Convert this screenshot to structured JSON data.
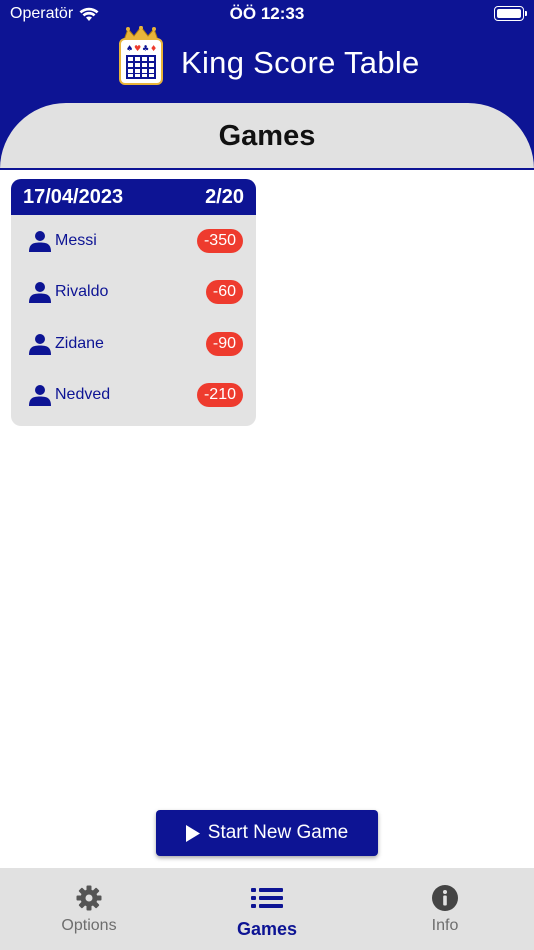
{
  "status_bar": {
    "carrier": "Operatör",
    "time": "ÖÖ 12:33"
  },
  "header": {
    "app_title": "King Score Table",
    "section_title": "Games"
  },
  "game": {
    "date": "17/04/2023",
    "progress": "2/20",
    "players": [
      {
        "name": "Messi",
        "score": "-350"
      },
      {
        "name": "Rivaldo",
        "score": "-60"
      },
      {
        "name": "Zidane",
        "score": "-90"
      },
      {
        "name": "Nedved",
        "score": "-210"
      }
    ]
  },
  "actions": {
    "start_label": "Start New Game"
  },
  "tabs": [
    {
      "label": "Options",
      "icon": "gear-icon"
    },
    {
      "label": "Games",
      "icon": "list-icon"
    },
    {
      "label": "Info",
      "icon": "info-icon"
    }
  ],
  "colors": {
    "primary": "#0d1494",
    "panel": "#e1e1e1",
    "score_badge": "#ee3b2e"
  }
}
